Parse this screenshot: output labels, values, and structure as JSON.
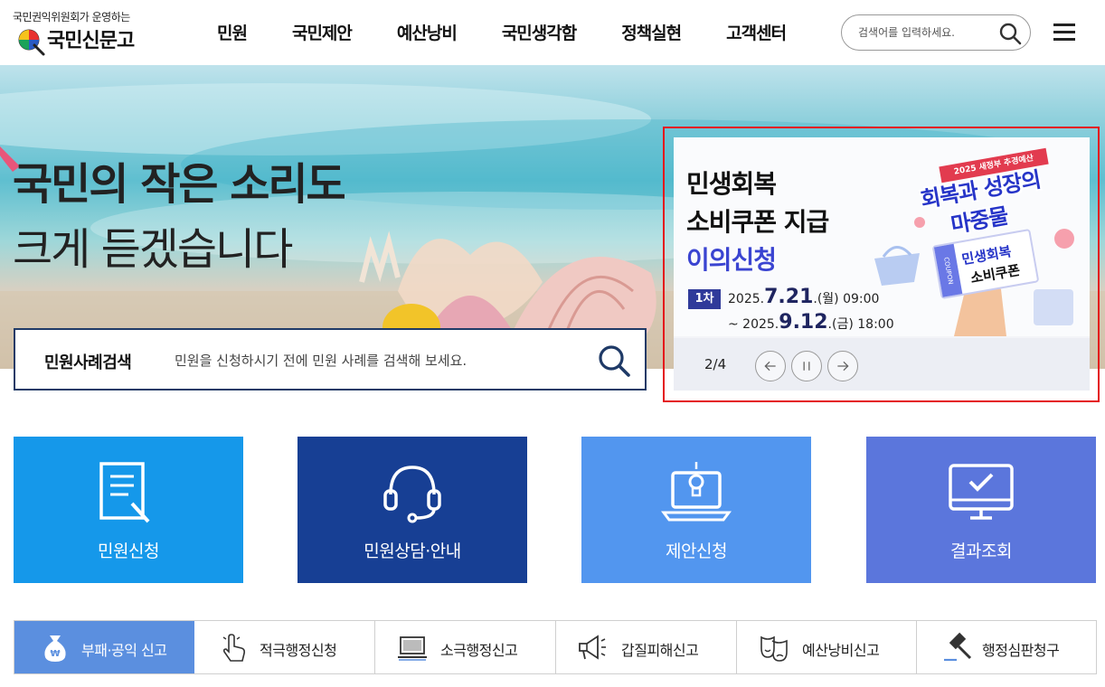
{
  "header": {
    "logo_subtitle": "국민권익위원회가 운영하는",
    "logo_name": "국민신문고",
    "nav": [
      "민원",
      "국민제안",
      "예산낭비",
      "국민생각함",
      "정책실현",
      "고객센터"
    ],
    "search_placeholder": "검색어를 입력하세요."
  },
  "hero": {
    "title_line1": "국민의 작은 소리도",
    "title_line2": "크게 듣겠습니다"
  },
  "case_search": {
    "label": "민원사례검색",
    "placeholder": "민원을 신청하시기 전에 민원 사례를 검색해 보세요."
  },
  "banner": {
    "title_line1": "민생회복",
    "title_line2": "소비쿠폰 지급",
    "title_line3": "이의신청",
    "round": "1차",
    "date1_prefix": "2025.",
    "date1_big": "7.21",
    "date1_suffix": ".(월) 09:00",
    "date2_prefix": "~ 2025.",
    "date2_big": "9.12",
    "date2_suffix": ".(금) 18:00",
    "tag": "2025 새정부 추경예산",
    "slogan_line1": "회복과 성장의",
    "slogan_line2": "마중물",
    "coupon_line1": "민생회복",
    "coupon_line2": "소비쿠폰",
    "coupon_side": "COUPON",
    "page_indicator": "2/4"
  },
  "tiles": [
    {
      "label": "민원신청",
      "color": "#1598ea",
      "icon": "document-pen-icon"
    },
    {
      "label": "민원상담·안내",
      "color": "#173f94",
      "icon": "headset-icon"
    },
    {
      "label": "제안신청",
      "color": "#5296ef",
      "icon": "laptop-lightbulb-icon"
    },
    {
      "label": "결과조회",
      "color": "#5b76dc",
      "icon": "monitor-check-icon"
    }
  ],
  "reports": [
    {
      "label": "부패·공익 신고",
      "icon": "money-bag-icon",
      "active": true
    },
    {
      "label": "적극행정신청",
      "icon": "hand-tap-icon",
      "active": false
    },
    {
      "label": "소극행정신고",
      "icon": "laptop-icon",
      "active": false
    },
    {
      "label": "갑질피해신고",
      "icon": "megaphone-icon",
      "active": false
    },
    {
      "label": "예산낭비신고",
      "icon": "theater-mask-icon",
      "active": false
    },
    {
      "label": "행정심판청구",
      "icon": "gavel-icon",
      "active": false
    }
  ]
}
